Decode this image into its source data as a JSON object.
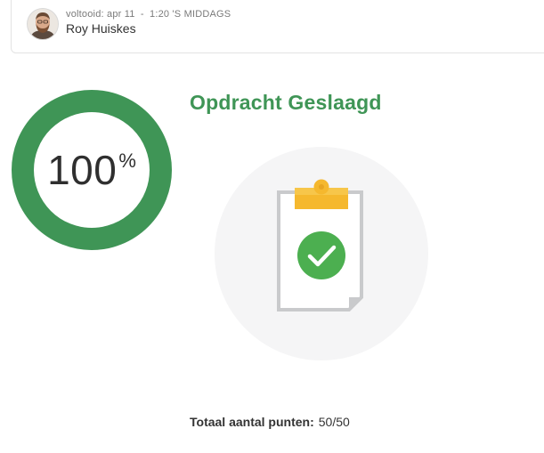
{
  "submission": {
    "status_label": "voltooid:",
    "date": "apr 11",
    "separator": "-",
    "time": "1:20 'S MIDDAGS",
    "user_name": "Roy Huiskes"
  },
  "result": {
    "score": "100",
    "percent_symbol": "%",
    "score_fraction": 1.0,
    "title": "Opdracht Geslaagd",
    "status_color": "#3f9556"
  },
  "points": {
    "label": "Totaal aantal punten:",
    "value": "50/50"
  },
  "icons": {
    "avatar": "user-avatar-photo",
    "illustration": "clipboard-checkmark-icon"
  }
}
